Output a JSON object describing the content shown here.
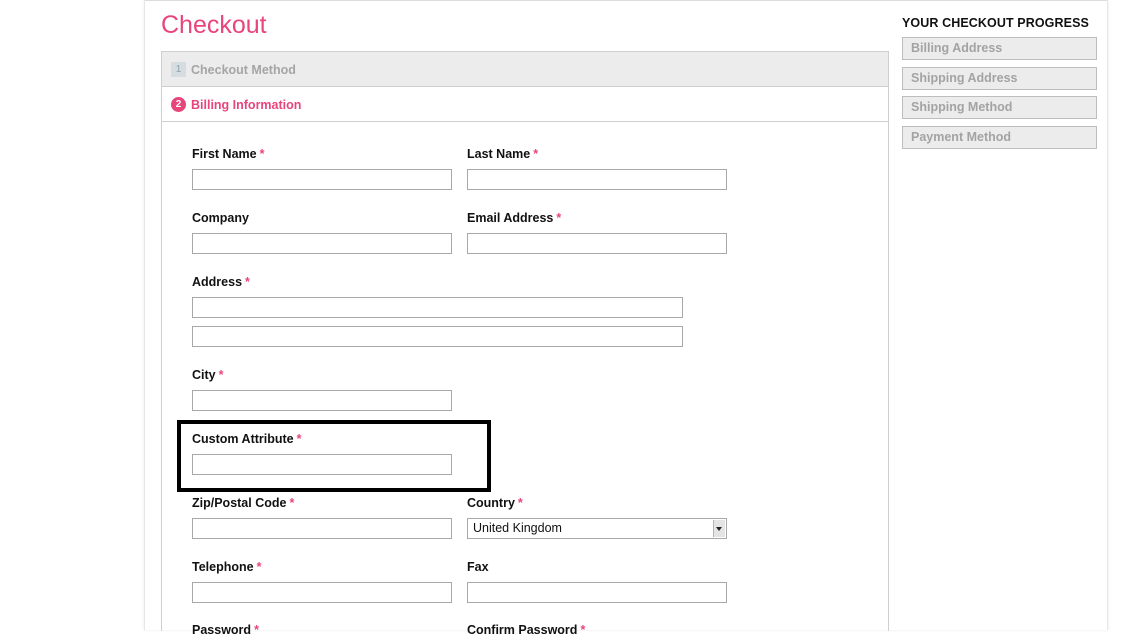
{
  "page": {
    "title": "Checkout"
  },
  "steps": [
    {
      "number": "1",
      "label": "Checkout Method"
    },
    {
      "number": "2",
      "label": "Billing Information"
    }
  ],
  "form": {
    "required_marker": "*",
    "first_name": {
      "label": "First Name",
      "value": ""
    },
    "last_name": {
      "label": "Last Name",
      "value": ""
    },
    "company": {
      "label": "Company",
      "value": ""
    },
    "email": {
      "label": "Email Address",
      "value": ""
    },
    "address": {
      "label": "Address",
      "line1": "",
      "line2": ""
    },
    "city": {
      "label": "City",
      "value": ""
    },
    "custom_attribute": {
      "label": "Custom Attribute",
      "value": ""
    },
    "zip": {
      "label": "Zip/Postal Code",
      "value": ""
    },
    "country": {
      "label": "Country",
      "selected": "United Kingdom"
    },
    "telephone": {
      "label": "Telephone",
      "value": ""
    },
    "fax": {
      "label": "Fax",
      "value": ""
    },
    "password": {
      "label": "Password"
    },
    "confirm_password": {
      "label": "Confirm Password"
    }
  },
  "progress": {
    "title": "YOUR CHECKOUT PROGRESS",
    "items": [
      "Billing Address",
      "Shipping Address",
      "Shipping Method",
      "Payment Method"
    ]
  },
  "colors": {
    "accent": "#e8457b",
    "inactive_text": "#a5a5a5",
    "panel_bg": "#ececec"
  }
}
